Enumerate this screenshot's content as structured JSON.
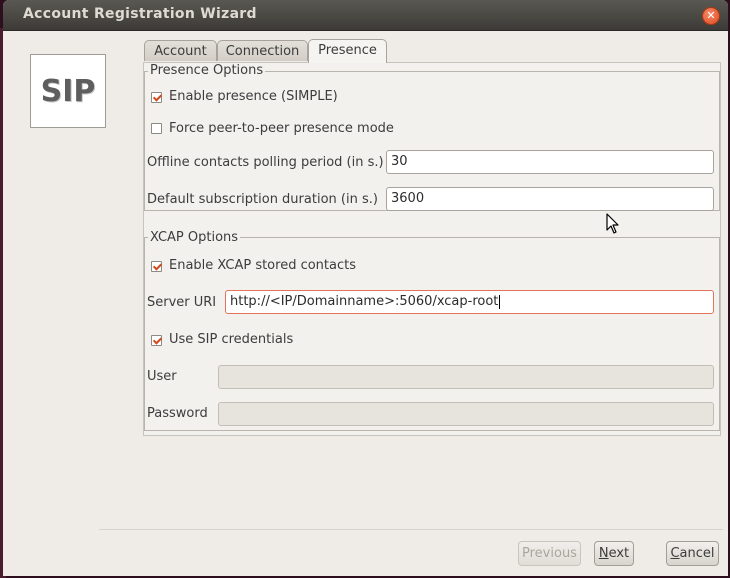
{
  "window": {
    "title": "Account Registration Wizard",
    "close_icon": "close-icon"
  },
  "logo": {
    "text": "SIP"
  },
  "tabs": [
    {
      "label": "Account",
      "active": false
    },
    {
      "label": "Connection",
      "active": false
    },
    {
      "label": "Presence",
      "active": true
    }
  ],
  "presence": {
    "legend": "Presence Options",
    "enable_presence": {
      "label": "Enable presence (SIMPLE)",
      "checked": true
    },
    "force_p2p": {
      "label": "Force peer-to-peer presence mode",
      "checked": false
    },
    "polling": {
      "label": "Offline contacts polling period (in s.)",
      "value": "30"
    },
    "subscription": {
      "label": "Default subscription duration (in s.)",
      "value": "3600"
    }
  },
  "xcap": {
    "legend": "XCAP Options",
    "enable_xcap": {
      "label": "Enable XCAP stored contacts",
      "checked": true
    },
    "server_uri": {
      "label": "Server URI",
      "value": "http://<IP/Domainname>:5060/xcap-root"
    },
    "use_sip_credentials": {
      "label": "Use SIP credentials",
      "checked": true
    },
    "user": {
      "label": "User",
      "value": ""
    },
    "password": {
      "label": "Password",
      "value": ""
    }
  },
  "buttons": {
    "previous": {
      "label": "Previous",
      "enabled": false
    },
    "next_prefix": "N",
    "next_rest": "ext",
    "cancel_prefix": "C",
    "cancel_rest": "ancel"
  },
  "colors": {
    "accent": "#d1491e",
    "titlebar": "#3c3b37",
    "window_bg": "#efebe7"
  }
}
